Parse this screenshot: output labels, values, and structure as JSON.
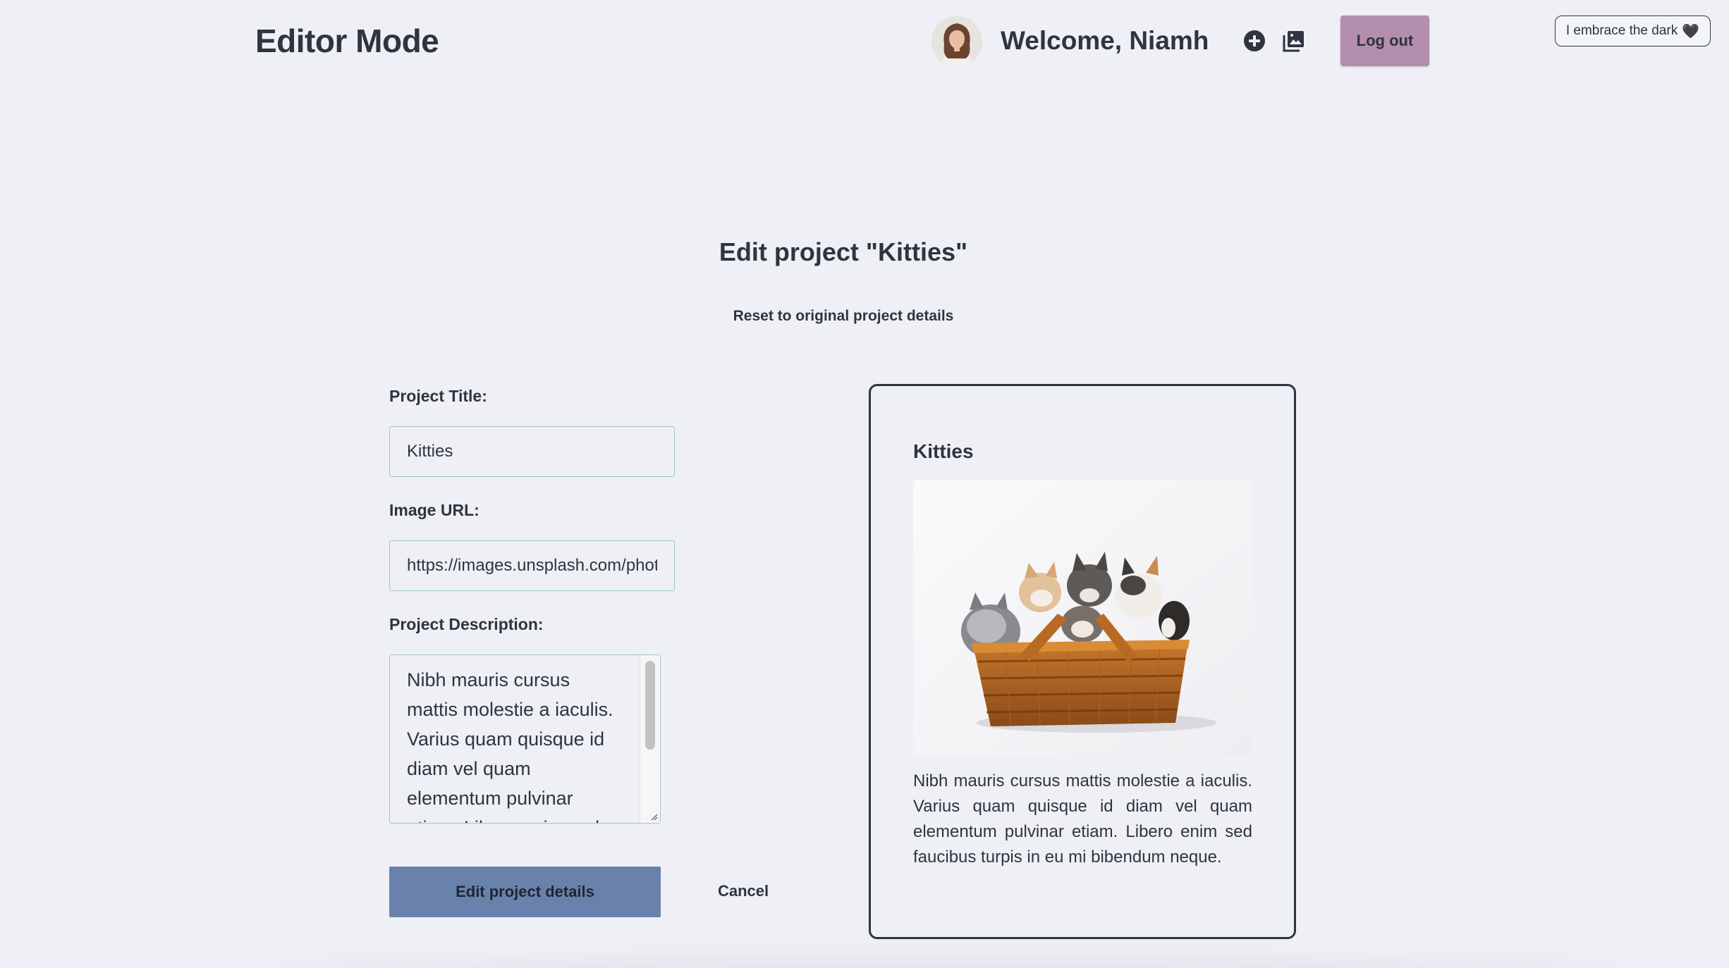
{
  "header": {
    "app_title": "Editor Mode",
    "welcome": "Welcome, Niamh",
    "icons": {
      "add": "plus-circle-icon",
      "gallery": "image-gallery-icon"
    },
    "logout_label": "Log out",
    "dark_toggle_label": "I embrace the dark",
    "dark_toggle_emoji": "🖤"
  },
  "main": {
    "heading": "Edit project \"Kitties\"",
    "reset_label": "Reset to original project details"
  },
  "form": {
    "title_label": "Project Title:",
    "title_value": "Kitties",
    "image_label": "Image URL:",
    "image_value": "https://images.unsplash.com/photo",
    "description_label": "Project Description:",
    "description_value": "Nibh mauris cursus mattis molestie a iaculis. Varius quam quisque id diam vel quam elementum pulvinar etiam. Libero enim sed faucibus turpis in eu mi bibendum neque.",
    "submit_label": "Edit project details",
    "cancel_label": "Cancel"
  },
  "preview": {
    "title": "Kitties",
    "image_subject": "kittens-in-wicker-basket",
    "description": "Nibh mauris cursus mattis molestie a iaculis. Varius quam quisque id diam vel quam elementum pulvinar etiam. Libero enim sed faucibus turpis in eu mi bibendum neque."
  },
  "colors": {
    "background": "#eff0f5",
    "text": "#2e3440",
    "logout_button": "#b48ead",
    "submit_button": "#6982ab",
    "input_border": "#9fc7cc"
  }
}
